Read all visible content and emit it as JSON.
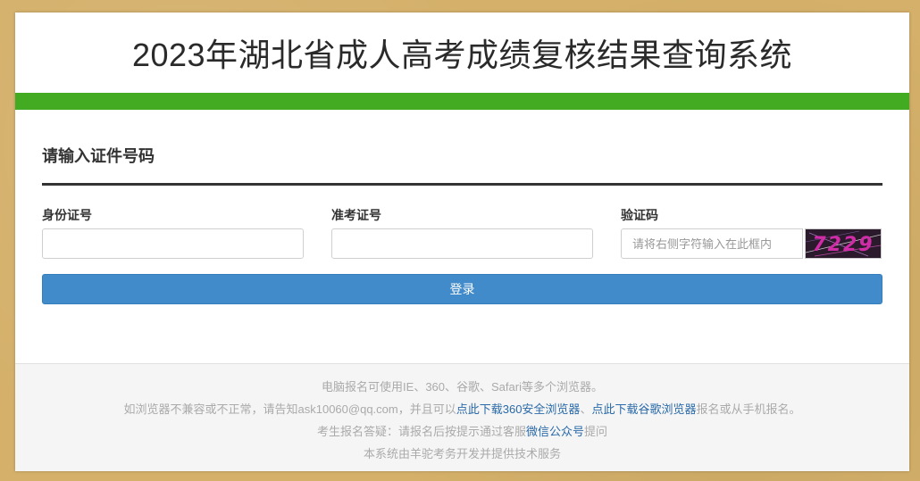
{
  "header": {
    "title": "2023年湖北省成人高考成绩复核结果查询系统"
  },
  "form": {
    "section_title": "请输入证件号码",
    "id_label": "身份证号",
    "exam_label": "准考证号",
    "captcha_label": "验证码",
    "captcha_placeholder": "请将右侧字符输入在此框内",
    "captcha_text": "7229",
    "login_label": "登录"
  },
  "footer": {
    "line1": "电脑报名可使用IE、360、谷歌、Safari等多个浏览器。",
    "line2_pre": "如浏览器不兼容或不正常，请告知ask10060@qq.com，并且可以",
    "line2_link1": "点此下载360安全浏览器",
    "line2_sep": "、",
    "line2_link2": "点此下载谷歌浏览器",
    "line2_post": "报名或从手机报名。",
    "line3_pre": "考生报名答疑：请报名后按提示通过客服",
    "line3_link": "微信公众号",
    "line3_post": "提问",
    "line4": "本系统由羊驼考务开发并提供技术服务"
  },
  "colors": {
    "background": "#d4b06a",
    "accent_bar": "#43ab22",
    "button": "#428bca",
    "link": "#2a6aa8"
  }
}
